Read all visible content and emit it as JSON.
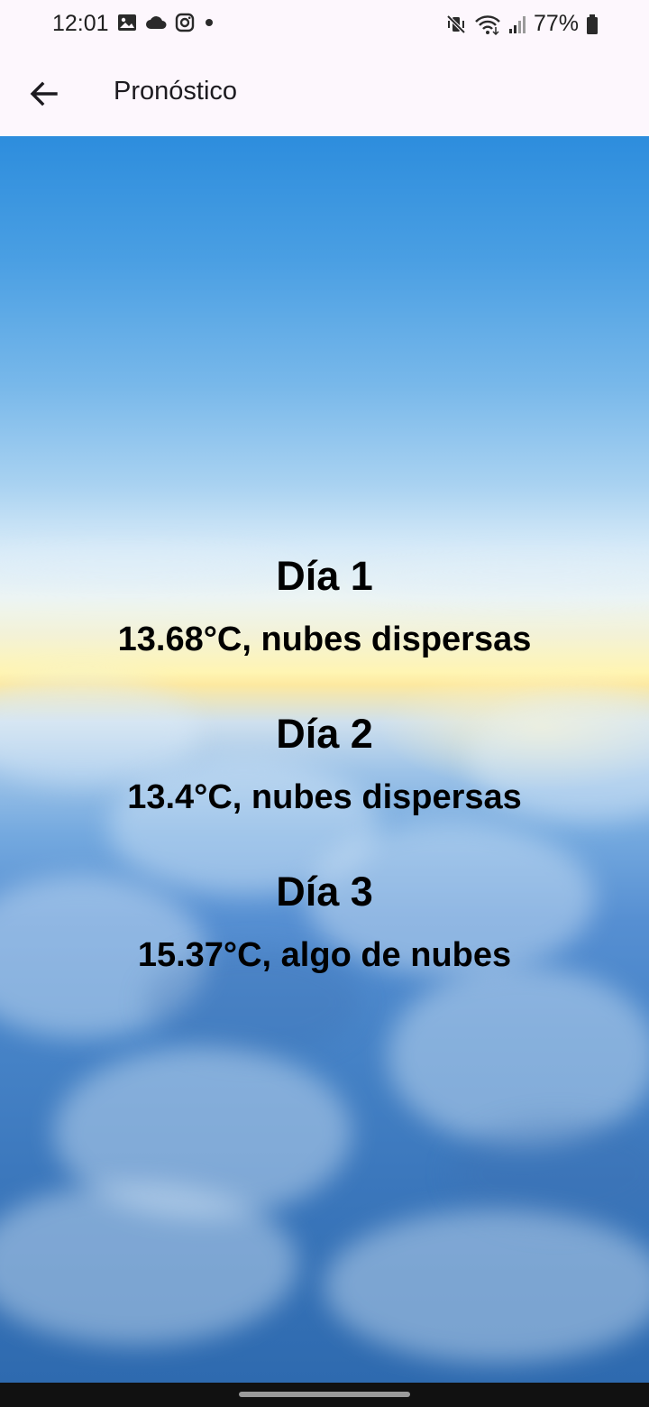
{
  "status_bar": {
    "time": "12:01",
    "battery": "77%",
    "left_icons": [
      "gallery-icon",
      "cloud-icon",
      "instagram-icon",
      "dot-icon"
    ],
    "right_icons": [
      "vibrate-icon",
      "wifi-icon",
      "signal-icon",
      "battery-icon"
    ]
  },
  "app_bar": {
    "title": "Pronóstico",
    "back_icon": "arrow-left-icon"
  },
  "forecast": {
    "days": [
      {
        "title": "Día 1",
        "description": "13.68°C, nubes dispersas"
      },
      {
        "title": "Día 2",
        "description": "13.4°C, nubes dispersas"
      },
      {
        "title": "Día 3",
        "description": "15.37°C, algo de nubes"
      }
    ]
  },
  "colors": {
    "app_bar_bg": "#fdf7fd",
    "text": "#000000",
    "sky_top": "#2d8ddd",
    "horizon": "#fff5b3",
    "clouds": "#4784c8"
  }
}
